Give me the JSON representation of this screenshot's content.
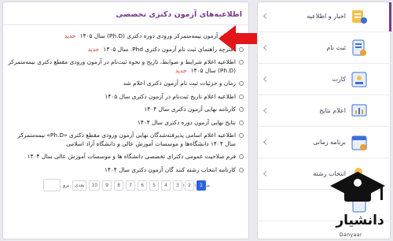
{
  "panel": {
    "title": "اطلاعیه‌های آزمون دکتری تخصصی",
    "items": [
      {
        "text": "ثبت‌نام آزمون نیمه‌متمرکز ورودی دوره دکتری (Ph.D) سال ۱۴۰۵",
        "badge": "جدید"
      },
      {
        "text": "دفترچه راهنمای ثبت نام آزمون دکتری Phd. سال ۱۴۰۵",
        "badge": "جدید"
      },
      {
        "text": "اطلاعیه اعلام شرایط و ضوابط، تاریخ و نحوه ثبت‌نام در آزمون ورودی مقطع دکتری نیمه‌متمرکز (Ph.D) سال ۱۴۰۵",
        "badge": "جدید"
      },
      {
        "text": "زمان و جزئیات ثبت نام آزمون دکتری اعلام شد",
        "badge": ""
      },
      {
        "text": "اطلاعیه اعلام تاریخ ثبت‌نام در آزمون دکتری سال ۱۴۰۵",
        "badge": ""
      },
      {
        "text": "کارنامه نهایی آزمون دکتری سال ۱۴۰۴",
        "badge": ""
      },
      {
        "text": "نتایج نهایی آزمون دوره دکتری سال ۱۴۰۴",
        "badge": ""
      },
      {
        "text": "اطلاعیه اعلام اسامی پذیرفته‌شدگان نهایی آزمون ورودی مقطع دکتری «Ph.D» نیمه‌متمرکز سال ۱۴۰۴ دانشگاه‌ها و موسسات آموزش عالی و دانشگاه آزاد اسلامی",
        "badge": ""
      },
      {
        "text": "فرم صلاحیت عمومی دکترای تخصصی دانشگاه ها و موسسات آموزش عالی سال ۱۴۰۴",
        "badge": ""
      },
      {
        "text": "کارنامه انتخاب رشته کنند گان آزمون دکتری سال ۱۴۰۴",
        "badge": ""
      }
    ]
  },
  "pager": {
    "pages": [
      "1",
      "2",
      "3",
      "4",
      "5",
      "6",
      "7",
      "8",
      "9",
      "10",
      "بعدی"
    ],
    "active": "1",
    "info": "صفحه ۱ از ۱۰",
    "goto_label": "برو"
  },
  "sidebar": {
    "items": [
      {
        "label": "اخبار و اطلاعیه",
        "icon": "megaphone-icon"
      },
      {
        "label": "ثبت نام",
        "icon": "register-form-icon"
      },
      {
        "label": "کارت",
        "icon": "id-card-icon"
      },
      {
        "label": "اعلام نتایج",
        "icon": "results-board-icon"
      },
      {
        "label": "برنامه زمانی",
        "icon": "calendar-icon"
      },
      {
        "label": "انتخاب رشته",
        "icon": "choose-major-icon"
      },
      {
        "label": "",
        "icon": "more-icon"
      }
    ]
  },
  "logo": {
    "name": "دانشیار",
    "sub": "Danyaar"
  },
  "colors": {
    "accent": "#7b3a8f",
    "new_badge": "#d9281c",
    "pager_active": "#2b63e0",
    "arrow": "#e3151b"
  }
}
